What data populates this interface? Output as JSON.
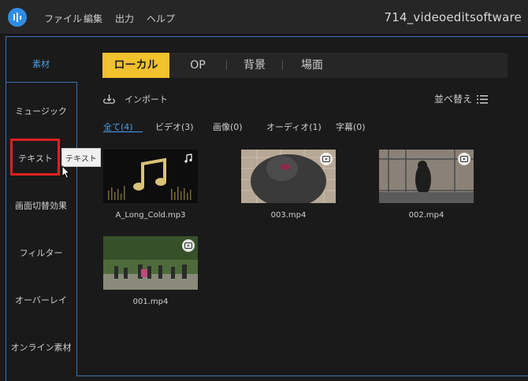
{
  "window": {
    "title": "714_videoeditsoftware"
  },
  "menubar": [
    "ファイル",
    "編集",
    "出力",
    "ヘルプ"
  ],
  "sidebar": {
    "items": [
      {
        "label": "素材",
        "active": true
      },
      {
        "label": "ミュージック"
      },
      {
        "label": "テキスト"
      },
      {
        "label": "画面切替効果"
      },
      {
        "label": "フィルター"
      },
      {
        "label": "オーバーレイ"
      },
      {
        "label": "オンライン素材"
      }
    ],
    "tooltip": "テキスト"
  },
  "tabs": [
    {
      "label": "ローカル",
      "active": true
    },
    {
      "label": "OP"
    },
    {
      "label": "背景"
    },
    {
      "label": "場面"
    }
  ],
  "toolbar": {
    "import_label": "インポート",
    "sort_label": "並べ替え"
  },
  "filters": [
    {
      "label": "全て(4)",
      "active": true
    },
    {
      "label": "ビデオ(3)"
    },
    {
      "label": "画像(0)"
    },
    {
      "label": "オーディオ(1)"
    },
    {
      "label": "字幕(0)"
    }
  ],
  "media": [
    {
      "name": "A_Long_Cold.mp3",
      "kind": "audio"
    },
    {
      "name": "003.mp4",
      "kind": "video"
    },
    {
      "name": "002.mp4",
      "kind": "video"
    },
    {
      "name": "001.mp4",
      "kind": "video"
    }
  ],
  "colors": {
    "accent": "#f2c12e",
    "link": "#4a9fe8",
    "border": "#3b72ad",
    "highlight": "#e02020"
  }
}
